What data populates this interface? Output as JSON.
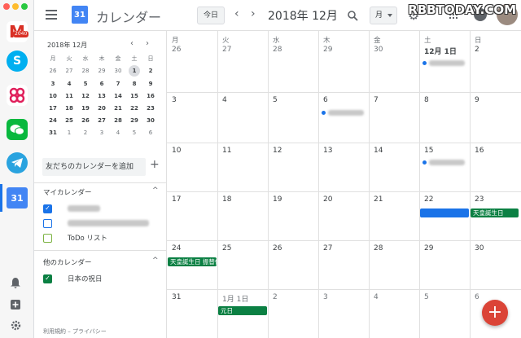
{
  "header": {
    "app_title": "カレンダー",
    "logo_day": "31",
    "today_label": "今日",
    "month_title": "2018年 12月",
    "view_label": "月",
    "watermark": "RBBTODAY.COM",
    "icons": [
      "menu-icon",
      "chevron-left-icon",
      "chevron-right-icon",
      "search-icon",
      "gear-icon",
      "apps-grid-icon",
      "account-icon"
    ]
  },
  "dock": {
    "gmail_badge": "2040",
    "apps": [
      "gmail-icon",
      "skype-icon",
      "slack-icon",
      "wechat-icon",
      "telegram-icon",
      "google-calendar-icon"
    ],
    "calendar_day": "31",
    "bottom_icons": [
      "bell-icon",
      "add-icon",
      "gear-icon"
    ]
  },
  "mini_calendar": {
    "title": "2018年 12月",
    "weekdays": [
      "月",
      "火",
      "水",
      "木",
      "金",
      "土",
      "日"
    ],
    "weeks": [
      [
        "26",
        "27",
        "28",
        "29",
        "30",
        "1",
        "2"
      ],
      [
        "3",
        "4",
        "5",
        "6",
        "7",
        "8",
        "9"
      ],
      [
        "10",
        "11",
        "12",
        "13",
        "14",
        "15",
        "16"
      ],
      [
        "17",
        "18",
        "19",
        "20",
        "21",
        "22",
        "23"
      ],
      [
        "24",
        "25",
        "26",
        "27",
        "28",
        "29",
        "30"
      ],
      [
        "31",
        "1",
        "2",
        "3",
        "4",
        "5",
        "6"
      ]
    ],
    "selected": "1"
  },
  "sidebar": {
    "add_friend_placeholder": "友だちのカレンダーを追加",
    "my_calendars_title": "マイカレンダー",
    "todo_label": "ToDo リスト",
    "other_calendars_title": "他のカレンダー",
    "holidays_label": "日本の祝日",
    "footer": "利用規約 – プライバシー"
  },
  "month_view": {
    "weekdays": [
      "月",
      "火",
      "水",
      "木",
      "金",
      "土",
      "日"
    ],
    "weeks": [
      [
        "26",
        "27",
        "28",
        "29",
        "30",
        "12月 1日",
        "2"
      ],
      [
        "3",
        "4",
        "5",
        "6",
        "7",
        "8",
        "9"
      ],
      [
        "10",
        "11",
        "12",
        "13",
        "14",
        "15",
        "16"
      ],
      [
        "17",
        "18",
        "19",
        "20",
        "21",
        "22",
        "23"
      ],
      [
        "24",
        "25",
        "26",
        "27",
        "28",
        "29",
        "30"
      ],
      [
        "31",
        "1月 1日",
        "2",
        "3",
        "4",
        "5",
        "6"
      ]
    ],
    "events": {
      "tenno_23": "天皇誕生日",
      "tenno_24": "天皇誕生日 振替休日",
      "ganjitsu": "元日"
    },
    "colors": {
      "holiday": "#0b8043",
      "personal": "#1a73e8",
      "todo": "#7cb342"
    }
  },
  "fab_label": "+"
}
